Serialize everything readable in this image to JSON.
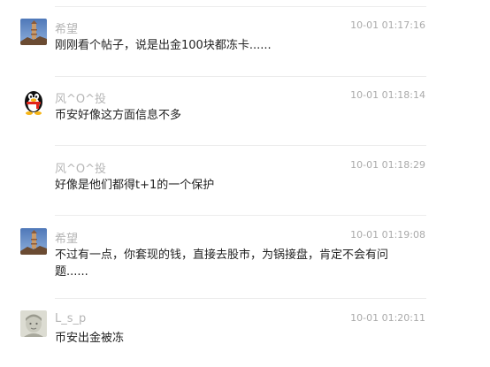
{
  "messages": [
    {
      "sender": "希望",
      "time": "10-01 01:17:16",
      "text": "刚刚看个帖子，说是出金100块都冻卡......",
      "avatar": "tower-photo-avatar"
    },
    {
      "sender": "风^O^投",
      "time": "10-01 01:18:14",
      "text": "币安好像这方面信息不多",
      "avatar": "qq-penguin-avatar"
    },
    {
      "sender": "风^O^投",
      "time": "10-01 01:18:29",
      "text": "好像是他们都得t+1的一个保护",
      "avatar": ""
    },
    {
      "sender": "希望",
      "time": "10-01 01:19:08",
      "text": "不过有一点，你套现的钱，直接去股市，为锅接盘，肯定不会有问题......",
      "avatar": "tower-photo-avatar"
    },
    {
      "sender": "L_s_p",
      "time": "10-01 01:20:11",
      "text": "币安出金被冻",
      "avatar": "sketch-portrait-avatar"
    }
  ]
}
